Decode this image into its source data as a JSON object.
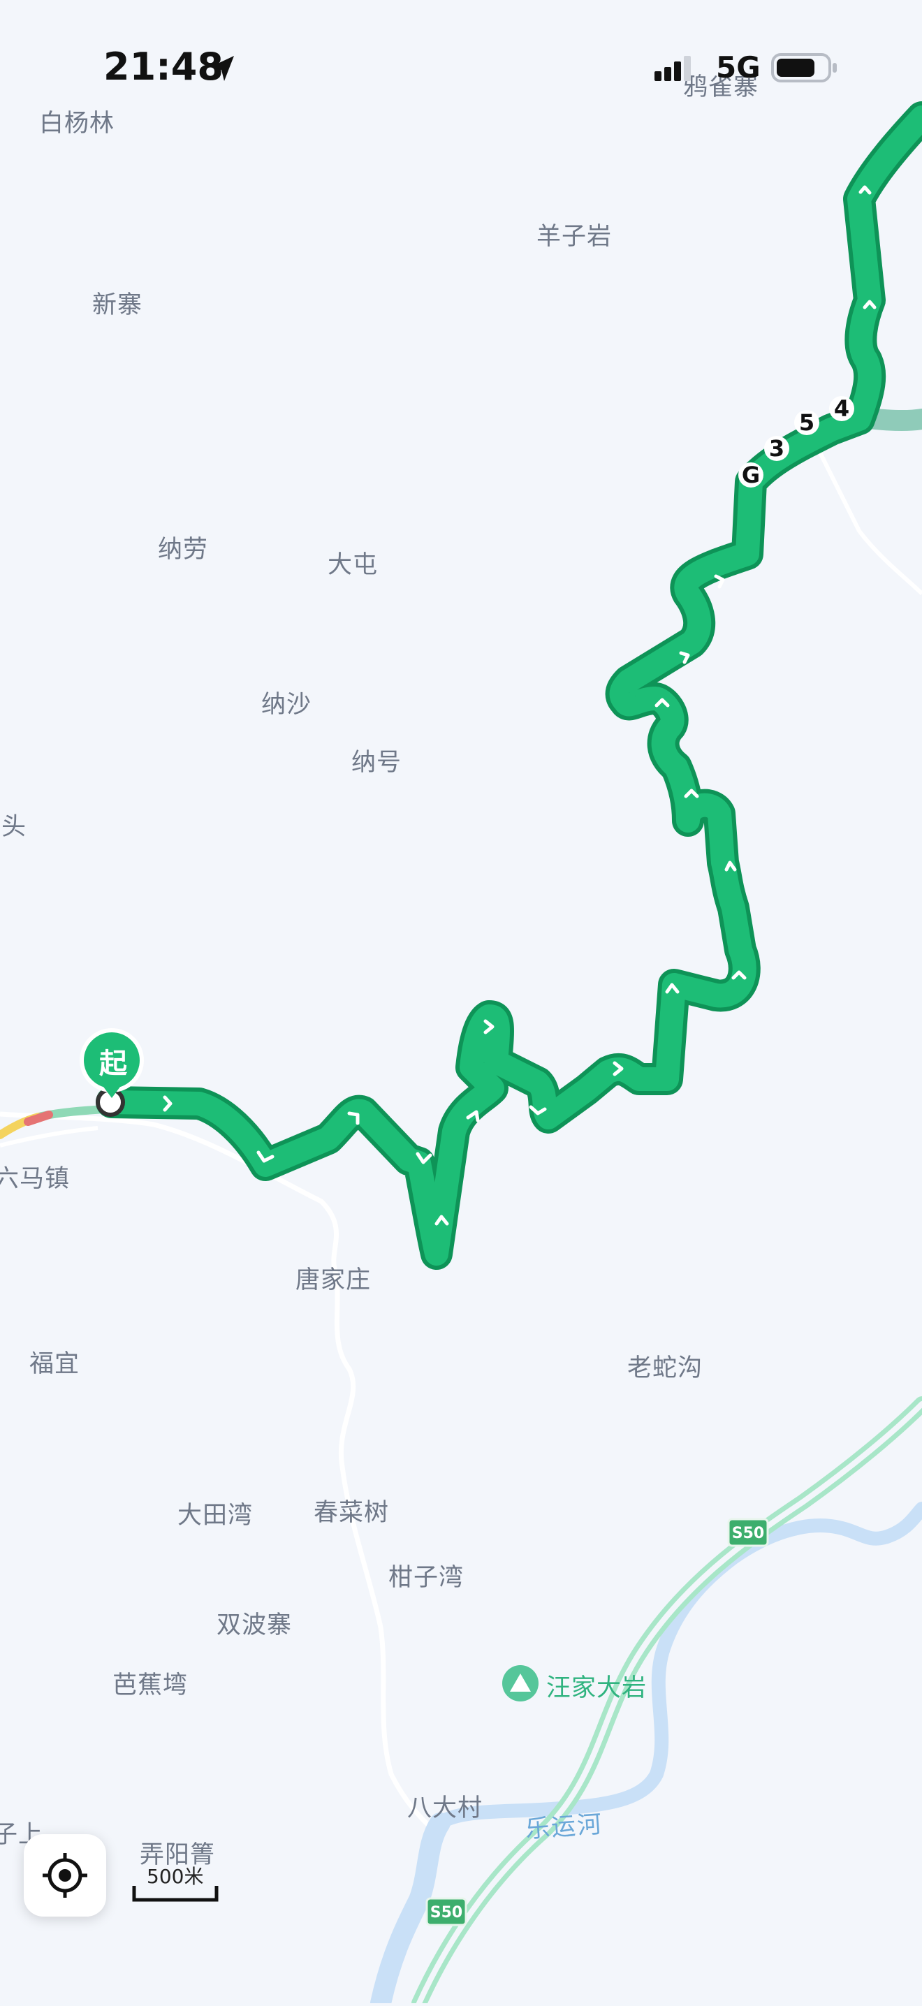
{
  "status_bar": {
    "time": "21:48",
    "network": "5G",
    "icons": [
      "location-arrow-icon",
      "signal-icon",
      "battery-icon"
    ]
  },
  "places": [
    {
      "id": "baiyanglin",
      "name": "白杨林"
    },
    {
      "id": "queque",
      "name": "鸦雀寨"
    },
    {
      "id": "yangziyan",
      "name": "羊子岩"
    },
    {
      "id": "xinzhai",
      "name": "新寨"
    },
    {
      "id": "nalao",
      "name": "纳劳"
    },
    {
      "id": "datun",
      "name": "大屯"
    },
    {
      "id": "nasha",
      "name": "纳沙"
    },
    {
      "id": "nahao",
      "name": "纳号"
    },
    {
      "id": "potou",
      "name": "坡头"
    },
    {
      "id": "liumazhen",
      "name": "六马镇"
    },
    {
      "id": "tangjiazhuang",
      "name": "唐家庄"
    },
    {
      "id": "fuyi",
      "name": "福宜"
    },
    {
      "id": "laoshegou",
      "name": "老蛇沟"
    },
    {
      "id": "datianwan",
      "name": "大田湾"
    },
    {
      "id": "chuncaishu",
      "name": "春菜树"
    },
    {
      "id": "ganziwan",
      "name": "柑子湾"
    },
    {
      "id": "shuangbozhai",
      "name": "双波寨"
    },
    {
      "id": "bajiaowan",
      "name": "芭蕉塆"
    },
    {
      "id": "badacun",
      "name": "八大村"
    },
    {
      "id": "ziishang",
      "name": "子上"
    },
    {
      "id": "nongyangqing",
      "name": "弄阳箐"
    }
  ],
  "route": {
    "start_label": "起",
    "road_name_chars": [
      "G",
      "3",
      "5",
      "4"
    ],
    "color": "#1dbd76",
    "outline_color": "#0e9357"
  },
  "poi": {
    "name": "汪家大岩",
    "icon": "mountain-icon"
  },
  "river": {
    "name": "乐运河"
  },
  "highway_shields": [
    {
      "label": "S50"
    },
    {
      "label": "S50"
    }
  ],
  "scale": {
    "label": "500米"
  },
  "locate_button": {
    "icon": "locate-icon"
  }
}
